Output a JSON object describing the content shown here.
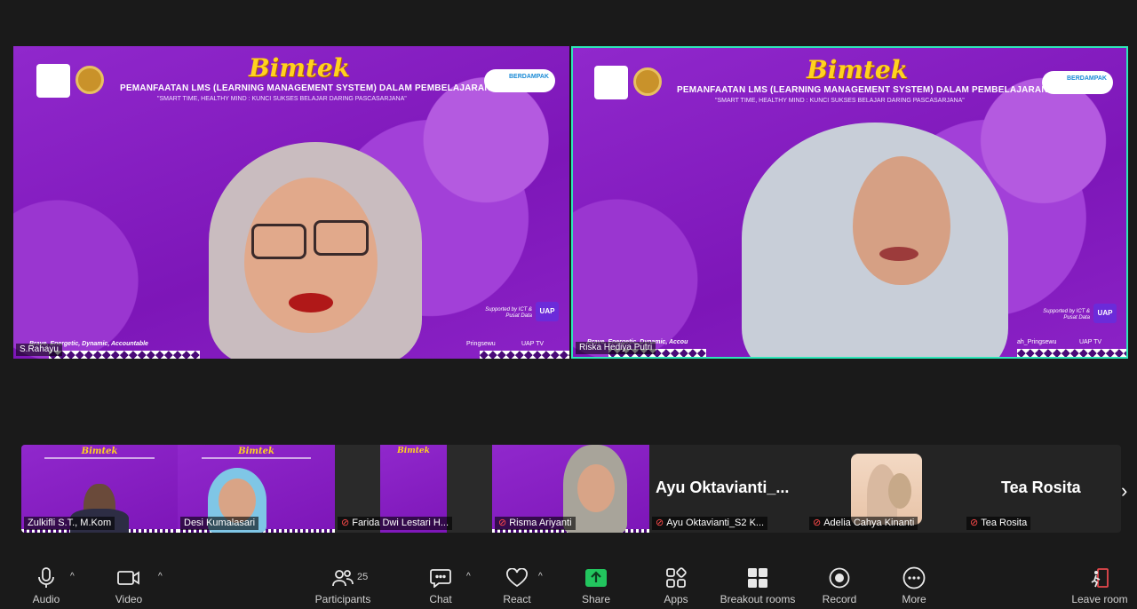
{
  "tiles": [
    {
      "name": "S.Rahayu",
      "banner": {
        "title": "Bimtek",
        "headline": "PEMANFAATAN LMS (LEARNING MANAGEMENT SYSTEM) DALAM PEMBELAJARAN",
        "tagline": "\"SMART TIME, HEALTHY MIND : KUNCI SUKSES BELAJAR DARING PASCASARJANA\"",
        "supported": "Supported by ICT & Pusat Data",
        "uap": "UAP",
        "footer_left": "Brave, Energetic, Dynamic, Accountable",
        "footer_mid": "Pringsewu",
        "footer_right": "UAP TV",
        "partner_logo": "BERDAMPAK"
      }
    },
    {
      "name": "Riska Hediya Putri",
      "banner": {
        "title": "Bimtek",
        "headline": "PEMANFAATAN LMS (LEARNING MANAGEMENT SYSTEM) DALAM PEMBELAJARAN",
        "tagline": "\"SMART TIME, HEALTHY MIND : KUNCI SUKSES BELAJAR DARING PASCASARJANA\"",
        "supported": "Supported by ICT & Pusat Data",
        "uap": "UAP",
        "footer_left": "Brave, Energetic, Dynamic, Accou",
        "footer_mid": "ah_Pringsewu",
        "footer_right": "UAP TV",
        "partner_logo": "BERDAMPAK"
      }
    }
  ],
  "filmstrip": [
    {
      "name": "Zulkifli S.T., M.Kom",
      "muted": false
    },
    {
      "name": "Desi Kumalasari",
      "muted": false
    },
    {
      "name": "Farida Dwi Lestari H...",
      "muted": true
    },
    {
      "name": "Risma Ariyanti",
      "muted": true
    },
    {
      "name": "Ayu Oktavianti_S2 K...",
      "display": "Ayu  Oktavianti_...",
      "muted": true
    },
    {
      "name": "Adelia Cahya Kinanti",
      "muted": true
    },
    {
      "name": "Tea Rosita",
      "display": "Tea Rosita",
      "muted": true
    }
  ],
  "toolbar": {
    "audio": "Audio",
    "video": "Video",
    "participants": "Participants",
    "participants_count": "25",
    "chat": "Chat",
    "react": "React",
    "share": "Share",
    "apps": "Apps",
    "breakout": "Breakout rooms",
    "record": "Record",
    "more": "More",
    "leave": "Leave room"
  },
  "colors": {
    "active_speaker_border": "#2ee6b8",
    "share_green": "#22c55e",
    "banner_purple": "#8a1fc4",
    "leave_red": "#e5484d"
  }
}
